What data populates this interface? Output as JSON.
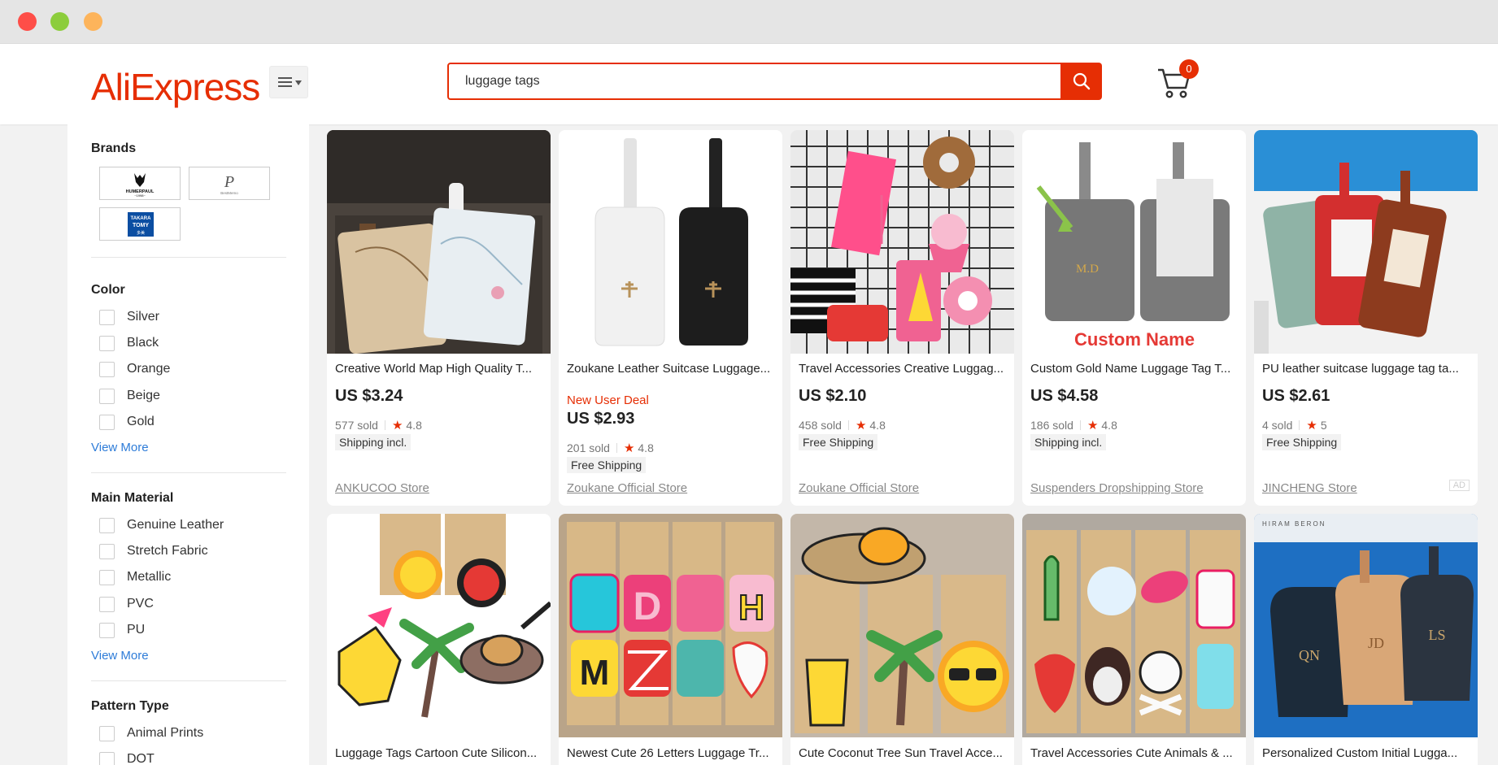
{
  "window": {
    "buttons": [
      "close",
      "minimize",
      "zoom"
    ]
  },
  "header": {
    "logo": "AliExpress",
    "search": {
      "value": "luggage tags"
    },
    "cart_count": "0"
  },
  "sidebar": {
    "brands": {
      "title": "Brands",
      "items": [
        "HUMERPAUL",
        "BestMemo",
        "TAKARA TOMY"
      ]
    },
    "color": {
      "title": "Color",
      "items": [
        "Silver",
        "Black",
        "Orange",
        "Beige",
        "Gold"
      ],
      "view_more": "View More"
    },
    "material": {
      "title": "Main Material",
      "items": [
        "Genuine Leather",
        "Stretch Fabric",
        "Metallic",
        "PVC",
        "PU"
      ],
      "view_more": "View More"
    },
    "pattern": {
      "title": "Pattern Type",
      "items": [
        "Animal Prints",
        "DOT"
      ]
    }
  },
  "products": [
    {
      "title": "Creative World Map High Quality T...",
      "price": "US $3.24",
      "sold": "577 sold",
      "rating": "4.8",
      "shipping": "Shipping incl.",
      "store": "ANKUCOO Store"
    },
    {
      "title": "Zoukane Leather Suitcase Luggage...",
      "deal": "New User Deal",
      "price": "US $2.93",
      "sold": "201 sold",
      "rating": "4.8",
      "shipping": "Free Shipping",
      "store": "Zoukane Official Store"
    },
    {
      "title": "Travel Accessories Creative Luggag...",
      "price": "US $2.10",
      "sold": "458 sold",
      "rating": "4.8",
      "shipping": "Free Shipping",
      "store": "Zoukane Official Store"
    },
    {
      "title": "Custom Gold Name Luggage Tag T...",
      "price": "US $4.58",
      "sold": "186 sold",
      "rating": "4.8",
      "shipping": "Shipping incl.",
      "store": "Suspenders Dropshipping Store",
      "image_text": [
        "M.D",
        "Custom Name"
      ]
    },
    {
      "title": "PU leather suitcase luggage tag ta...",
      "price": "US $2.61",
      "sold": "4 sold",
      "rating": "5",
      "shipping": "Free Shipping",
      "store": "JINCHENG Store",
      "ad": "AD"
    },
    {
      "title": "Luggage Tags Cartoon Cute Silicon..."
    },
    {
      "title": "Newest Cute 26 Letters Luggage Tr..."
    },
    {
      "title": "Cute Coconut Tree Sun Travel Acce..."
    },
    {
      "title": "Travel Accessories Cute Animals & ..."
    },
    {
      "title": "Personalized Custom Initial Lugga...",
      "image_text": [
        "HIRAM BERON",
        "QN",
        "JD",
        "LS"
      ]
    }
  ],
  "colors": {
    "accent": "#e62e04",
    "link": "#2e7cd8"
  }
}
